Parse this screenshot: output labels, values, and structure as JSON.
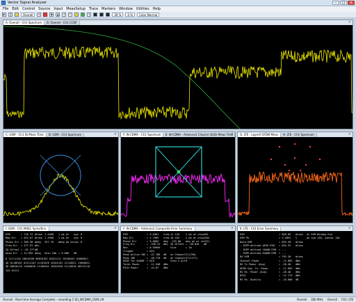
{
  "window": {
    "title": "Vector Signal Analyzer",
    "minimize": "–",
    "maximize": "□",
    "close": "x"
  },
  "menu": [
    "File",
    "Edit",
    "Control",
    "Source",
    "Input",
    "MeasSetup",
    "Trace",
    "Markers",
    "Window",
    "Utilities",
    "Help"
  ],
  "toolbar": {
    "combo_overall": "Overall",
    "combo_pct": "39 %",
    "combo_zero": "0 %",
    "combo_color": "Color Normal"
  },
  "top_pane": {
    "tabs": [
      "A: Overall - Ch1 Spectrum",
      "B: Overall - Ch1 CCDF"
    ],
    "trace_color": "#f2ee00",
    "curve_color": "#2fb53a"
  },
  "mid_panes": [
    {
      "tabs": [
        "C: GSM - Ch1 IQ Meas Time",
        "D: GSM - Ch1 Spectrum"
      ],
      "trace_color": "#f2ee00",
      "iq_color": "#4aa3ff",
      "circle_color": "#3d8de0"
    },
    {
      "tabs": [
        "F: W-CDMA - Ch1 Spectrum",
        "E: W-CDMA - Antenna1 Chip(m) Q(IQ) Meas Time"
      ],
      "trace_color": "#ff2cff",
      "box_color": "#2fd0d0"
    },
    {
      "tabs": [
        "G: LTE - Layer0 OFDM Meas",
        "H: LTE - Ch1 Spectrum"
      ],
      "trace_color": "#ff6a1a"
    }
  ],
  "gsm_syms": {
    "tab": "I: GSM - Ch1 MSK1 Syms/Errs",
    "rows": [
      [
        "EVM",
        "= 718.72",
        "mVrms",
        "1.4468",
        "% pk at",
        "sym",
        "0"
      ],
      [
        "Mag Err",
        "= 623.67",
        "mVrms",
        "1.1900",
        "% pk at",
        "sym",
        "0"
      ],
      [
        "Phase Err",
        "= 309.58",
        "mdeg",
        "357.70",
        "mdeg pk at",
        "sym",
        "0"
      ],
      [
        "Freq Err",
        "= 277.97",
        "mHz",
        "",
        "",
        "",
        ""
      ],
      [
        "IQ Offset",
        "= -61.277",
        "dB",
        "",
        "",
        "",
        ""
      ],
      [
        "Quad Err",
        "= 22.695",
        "mdeg",
        "Gain Imb",
        "= 0.000",
        "dB",
        ""
      ]
    ],
    "bits": [
      "0  11111110 10010100 00010101 01011111 10100101 01000011",
      "48 01100101 01111101 11101010 10101101 11110011 11000011",
      "96 00010110 11000010 11100101 10101010 11110010 00111110",
      "144 01111"
    ]
  },
  "wcdma_err": {
    "tab": "F: W-CDMA - Antenna1 Composite Error Summary",
    "rows": [
      [
        "EVM",
        "= 9.0361",
        "%rms",
        "11.126",
        "% pk at chip",
        "494"
      ],
      [
        "Mag Err",
        "= 2.7905",
        "%rms",
        "10.103",
        "% pk at chip",
        "2464"
      ],
      [
        "Phase Err",
        "= 5.0063",
        "deg",
        "-133.08",
        "deg pk at chip",
        "1312"
      ],
      [
        "",
        "",
        "",
        "",
        "",
        ""
      ],
      [
        "Freq Err",
        "= -338.22",
        "mHz",
        "IQ Offset",
        "= -48.826",
        "dB"
      ],
      [
        "Rho",
        "= 0.99969",
        "",
        "Slot",
        "= 10",
        ""
      ],
      [
        "Trigger",
        "= N/A",
        "",
        "",
        "",
        ""
      ],
      [
        "",
        "",
        "",
        "",
        "",
        ""
      ],
      [
        "Peak Active CDE",
        "= -47.768",
        "dB",
        "at Channel",
        "S1(258)",
        ""
      ],
      [
        "Peak CDE",
        "= -48.778",
        "dB",
        "at Channel",
        "S7(1271)",
        ""
      ],
      [
        "RCDE for 64QAM",
        "= N/A",
        "",
        "Chan's Act",
        "6",
        ""
      ],
      [
        "",
        "",
        "",
        "",
        "",
        ""
      ],
      [
        "Total Power",
        "= -11.948",
        "dBm",
        "",
        "",
        ""
      ],
      [
        "PSCH Power",
        "= -24.87",
        "dBm",
        "",
        "",
        ""
      ]
    ]
  },
  "lte_err": {
    "tab": "K: LTE - Ch1 Error Summary",
    "rows": [
      [
        "EVM",
        "= 820.09",
        "m%rms",
        "at EVM Window End"
      ],
      [
        "EVM Pk",
        "= 3.4891",
        "%",
        "pk sym 158, subcar 146"
      ],
      [
        "Data EVM",
        "= 833.30",
        "m%rms",
        ""
      ],
      [
        "- 3GPP-defined QPSK EVM",
        "= 834.32",
        "m%rms",
        ""
      ],
      [
        "- 3GPP-defined 16QAM EVM",
        "= ---",
        "",
        ""
      ],
      [
        "- 3GPP-defined 64QAM EVM",
        "= ---",
        "",
        ""
      ],
      [
        "RS EVM",
        "= 792.30",
        "m%rms",
        ""
      ],
      [
        "Channel Power",
        "= -11.883",
        "dBm",
        ""
      ],
      [
        "RS Tx Power (Avg)",
        "= -28.48",
        "dBm",
        ""
      ],
      [
        "OFDM Sym. Tx. Power",
        "= -11.895",
        "dBm",
        ""
      ],
      [
        "RS Rx. Power (Avg)",
        "= -28.48",
        "dBm",
        ""
      ],
      [
        "RSSI",
        "= -12.175",
        "dBm",
        ""
      ],
      [
        "RS Rx. Quality",
        "= -10.800",
        "dB",
        ""
      ]
    ]
  },
  "statusbar": {
    "left": "Overall - Real time Average Complete - recording C:\\EI_WCDMA_GSM.cdf",
    "right": [
      "Overall",
      "300 MHz",
      "Overall",
      "Ch1: LTE"
    ]
  }
}
